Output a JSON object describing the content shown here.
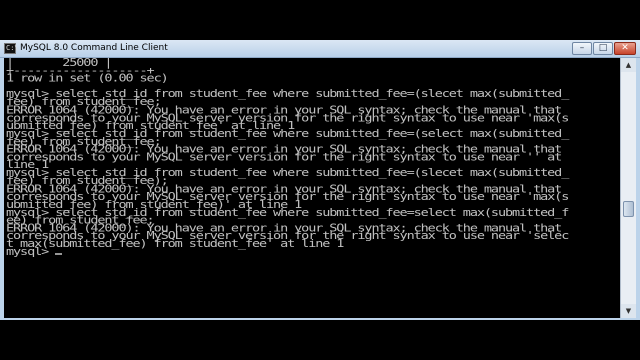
{
  "window": {
    "title": "MySQL 8.0 Command Line Client",
    "minimize_glyph": "–",
    "maximize_glyph": "□",
    "close_glyph": "✕",
    "icon_glyph": "C:\\"
  },
  "console": {
    "lines": [
      "|       25000 |",
      "+-------------------+",
      "1 row in set (0.00 sec)",
      "",
      "mysql> select std_id from student_fee where submitted_fee=(slecet max(submitted_",
      "fee) from student_fee;",
      "ERROR 1064 (42000): You have an error in your SQL syntax; check the manual that",
      "corresponds to your MySQL server version for the right syntax to use near 'max(s",
      "ubmitted_fee) from student_fee' at line 1",
      "mysql> select std_id from student_fee where submitted_fee=(select max(submitted_",
      "fee) from student_fee;",
      "ERROR 1064 (42000): You have an error in your SQL syntax; check the manual that",
      "corresponds to your MySQL server version for the right syntax to use near '' at",
      "line 1",
      "mysql> select std_id from student_fee where submitted_fee=(slecet max(submitted_",
      "fee) from student_fee);",
      "ERROR 1064 (42000): You have an error in your SQL syntax; check the manual that",
      "corresponds to your MySQL server version for the right syntax to use near 'max(s",
      "ubmitted_fee) from student_fee)' at line 1",
      "mysql> select std_id from student_fee where submitted_fee=select max(submitted_f",
      "ee) from student_fee;",
      "ERROR 1064 (42000): You have an error in your SQL syntax; check the manual that",
      "corresponds to your MySQL server version for the right syntax to use near 'selec",
      "t max(submitted_fee) from student_fee' at line 1",
      "mysql> "
    ]
  },
  "scrollbar": {
    "up_glyph": "▲",
    "down_glyph": "▼"
  },
  "colors": {
    "console_background": "#000000",
    "console_text": "#c0c0c0",
    "titlebar": "#c8dbef",
    "close_button": "#c7432b"
  },
  "icons": [
    "cmd-app-icon",
    "minimize-icon",
    "maximize-icon",
    "close-icon",
    "scroll-up-icon",
    "scroll-down-icon"
  ]
}
